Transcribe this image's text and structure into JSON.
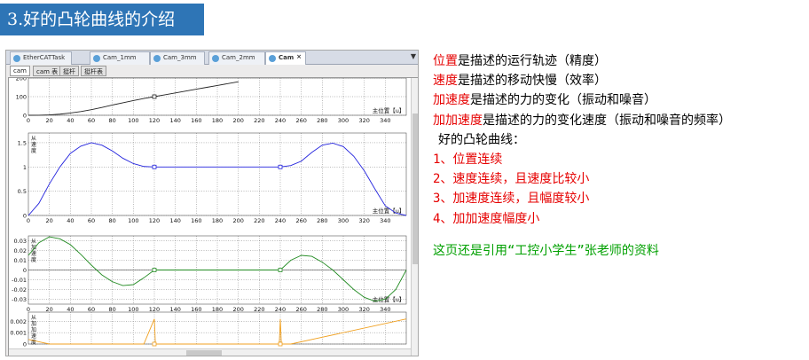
{
  "header": {
    "title": "3.好的凸轮曲线的介绍"
  },
  "window": {
    "tabs": [
      {
        "label": "EtherCATTask",
        "active": false
      },
      {
        "label": "Cam_1mm",
        "active": false
      },
      {
        "label": "Cam_3mm",
        "active": false
      },
      {
        "label": "Cam_2mm",
        "active": false
      },
      {
        "label": "Cam",
        "active": true
      }
    ],
    "subtabs": [
      {
        "label": "cam",
        "active": true
      },
      {
        "label": "cam 表",
        "active": false
      },
      {
        "label": "挺杆",
        "active": false
      },
      {
        "label": "挺杆表",
        "active": false
      }
    ],
    "axis_label": "主位置【u】",
    "colors": {
      "position": "#222222",
      "velocity": "#2222dd",
      "acceleration": "#228b22",
      "jerk": "#f0a020"
    }
  },
  "chart_data": [
    {
      "type": "line",
      "name": "position",
      "x": [
        0,
        10,
        20,
        30,
        40,
        50,
        60,
        70,
        80,
        90,
        100,
        110,
        120,
        130,
        140,
        150,
        160,
        170,
        180,
        190,
        200
      ],
      "values": [
        0,
        0.3,
        2,
        6,
        12,
        20,
        30,
        42,
        55,
        67,
        79,
        90,
        100,
        110,
        120,
        130,
        140,
        150,
        160,
        170,
        180
      ],
      "yticks": [
        "200",
        "100",
        "0"
      ],
      "ylim": [
        0,
        200
      ],
      "xticks": [
        "0",
        "20",
        "40",
        "60",
        "80",
        "100",
        "120",
        "140",
        "160",
        "180",
        "200",
        "220",
        "240",
        "260",
        "280",
        "300",
        "320",
        "340"
      ],
      "xlabel": "主位置【u】"
    },
    {
      "type": "line",
      "name": "velocity",
      "x": [
        0,
        10,
        20,
        30,
        40,
        50,
        60,
        70,
        80,
        90,
        100,
        110,
        120,
        240,
        250,
        260,
        270,
        280,
        290,
        300,
        310,
        320,
        330,
        340,
        350,
        360
      ],
      "values": [
        0,
        0.25,
        0.65,
        1.0,
        1.28,
        1.43,
        1.5,
        1.45,
        1.33,
        1.18,
        1.07,
        1.01,
        1.0,
        1.0,
        1.03,
        1.12,
        1.3,
        1.45,
        1.49,
        1.42,
        1.22,
        0.92,
        0.55,
        0.2,
        0.05,
        0
      ],
      "ylabel": "从 速 度",
      "yticks": [
        "1.5",
        "1",
        "0.5",
        "0"
      ],
      "ylim": [
        0,
        1.7
      ],
      "xticks": [
        "0",
        "20",
        "40",
        "60",
        "80",
        "100",
        "120",
        "140",
        "160",
        "180",
        "200",
        "220",
        "240",
        "260",
        "280",
        "300",
        "320",
        "340"
      ],
      "xlabel": "主位置【u】"
    },
    {
      "type": "line",
      "name": "acceleration",
      "x": [
        0,
        10,
        20,
        30,
        40,
        50,
        60,
        70,
        80,
        90,
        100,
        110,
        120,
        240,
        250,
        260,
        270,
        280,
        290,
        300,
        310,
        320,
        330,
        340,
        350,
        360
      ],
      "values": [
        0.015,
        0.028,
        0.034,
        0.032,
        0.026,
        0.016,
        0.005,
        -0.005,
        -0.012,
        -0.016,
        -0.015,
        -0.008,
        0,
        0,
        0.01,
        0.015,
        0.014,
        0.008,
        0,
        -0.01,
        -0.02,
        -0.028,
        -0.032,
        -0.03,
        -0.02,
        0
      ],
      "ylabel": "从 加 速 度",
      "yticks": [
        "0.03",
        "0.02",
        "0.01",
        "0",
        "-0.01",
        "-0.02",
        "-0.03"
      ],
      "ylim": [
        -0.035,
        0.035
      ],
      "xticks": [
        "0",
        "20",
        "40",
        "60",
        "80",
        "100",
        "120",
        "140",
        "160",
        "180",
        "200",
        "220",
        "240",
        "260",
        "280",
        "300",
        "320",
        "340"
      ],
      "xlabel": "主位置【u】"
    },
    {
      "type": "line",
      "name": "jerk",
      "x": [
        0,
        10,
        20,
        110,
        120,
        121,
        239,
        240,
        241,
        250,
        360
      ],
      "values": [
        0.0004,
        0.0002,
        0,
        0,
        0.0022,
        0,
        0,
        0.0022,
        0,
        0,
        0.0022
      ],
      "ylabel": "从 加 加 速 度",
      "yticks": [
        "0.002",
        "0.001",
        "0"
      ],
      "ylim": [
        0,
        0.0028
      ]
    }
  ],
  "notes": {
    "lines": [
      {
        "strong": "位置",
        "rest": "是描述的运行轨迹（精度）"
      },
      {
        "strong": "速度",
        "rest": "是描述的移动快慢（效率）"
      },
      {
        "strong": "加速度",
        "rest": "是描述的力的变化（振动和噪音）"
      },
      {
        "strong": "加加速度",
        "rest": "是描述的力的变化速度（振动和噪音的频率）"
      }
    ],
    "heading": "好的凸轮曲线：",
    "items": [
      "1、位置连续",
      "2、速度连续，且速度比较小",
      "3、加速度连续，且幅度较小",
      "4、加加速度幅度小"
    ],
    "footer": "这页还是引用“工控小学生”张老师的资料"
  }
}
